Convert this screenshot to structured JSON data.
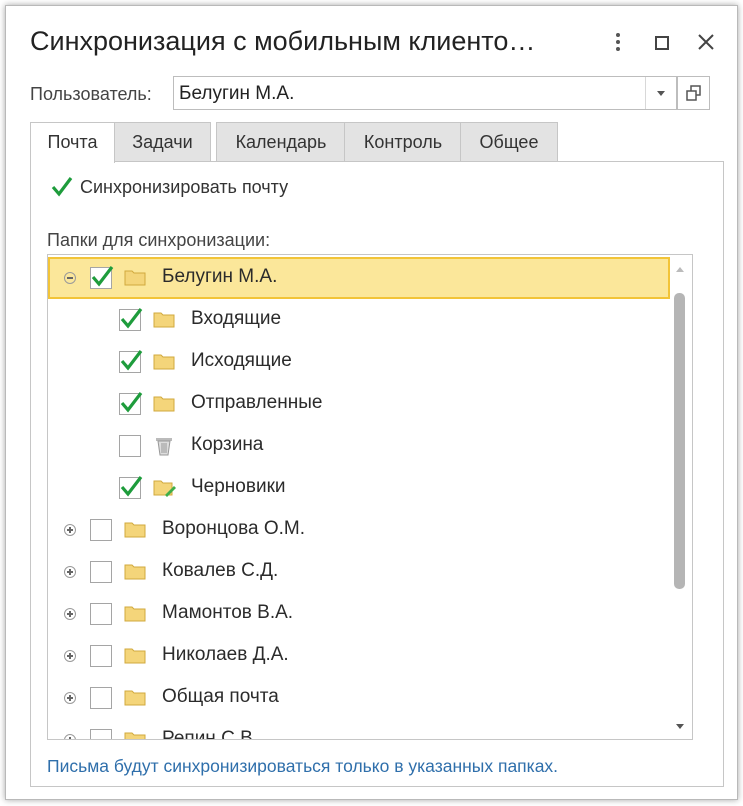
{
  "window": {
    "title": "Синхронизация с мобильным клиенто…"
  },
  "user": {
    "label": "Пользователь:",
    "value": "Белугин М.А."
  },
  "tabs": [
    {
      "label": "Почта",
      "active": true
    },
    {
      "label": "Задачи",
      "active": false
    },
    {
      "label": "Календарь",
      "active": false
    },
    {
      "label": "Контроль",
      "active": false
    },
    {
      "label": "Общее",
      "active": false
    }
  ],
  "mail": {
    "sync_label": "Синхронизировать почту",
    "sync_checked": true,
    "folders_label": "Папки для синхронизации:",
    "tree": [
      {
        "label": "Белугин М.А.",
        "level": 0,
        "expander": "minus",
        "checked": true,
        "icon": "folder-icon",
        "selected": true
      },
      {
        "label": "Входящие",
        "level": 1,
        "expander": "none",
        "checked": true,
        "icon": "folder-icon",
        "selected": false
      },
      {
        "label": "Исходящие",
        "level": 1,
        "expander": "none",
        "checked": true,
        "icon": "folder-icon",
        "selected": false
      },
      {
        "label": "Отправленные",
        "level": 1,
        "expander": "none",
        "checked": true,
        "icon": "folder-icon",
        "selected": false
      },
      {
        "label": "Корзина",
        "level": 1,
        "expander": "none",
        "checked": false,
        "icon": "trash-icon",
        "selected": false
      },
      {
        "label": "Черновики",
        "level": 1,
        "expander": "none",
        "checked": true,
        "icon": "folder-edit-icon",
        "selected": false
      },
      {
        "label": "Воронцова О.М.",
        "level": 0,
        "expander": "plus",
        "checked": false,
        "icon": "folder-icon",
        "selected": false
      },
      {
        "label": "Ковалев С.Д.",
        "level": 0,
        "expander": "plus",
        "checked": false,
        "icon": "folder-icon",
        "selected": false
      },
      {
        "label": "Мамонтов В.А.",
        "level": 0,
        "expander": "plus",
        "checked": false,
        "icon": "folder-icon",
        "selected": false
      },
      {
        "label": "Николаев Д.А.",
        "level": 0,
        "expander": "plus",
        "checked": false,
        "icon": "folder-icon",
        "selected": false
      },
      {
        "label": "Общая почта",
        "level": 0,
        "expander": "plus",
        "checked": false,
        "icon": "folder-icon",
        "selected": false
      },
      {
        "label": "Репин С.В.",
        "level": 0,
        "expander": "plus",
        "checked": false,
        "icon": "folder-icon",
        "selected": false
      }
    ],
    "note": "Письма будут синхронизироваться только в указанных папках."
  },
  "colors": {
    "check": "#1e9c3c",
    "folder": "#f4d57a",
    "selected_row": "#fbe79a",
    "selected_border": "#f2c438",
    "note_text": "#2f6fab"
  }
}
